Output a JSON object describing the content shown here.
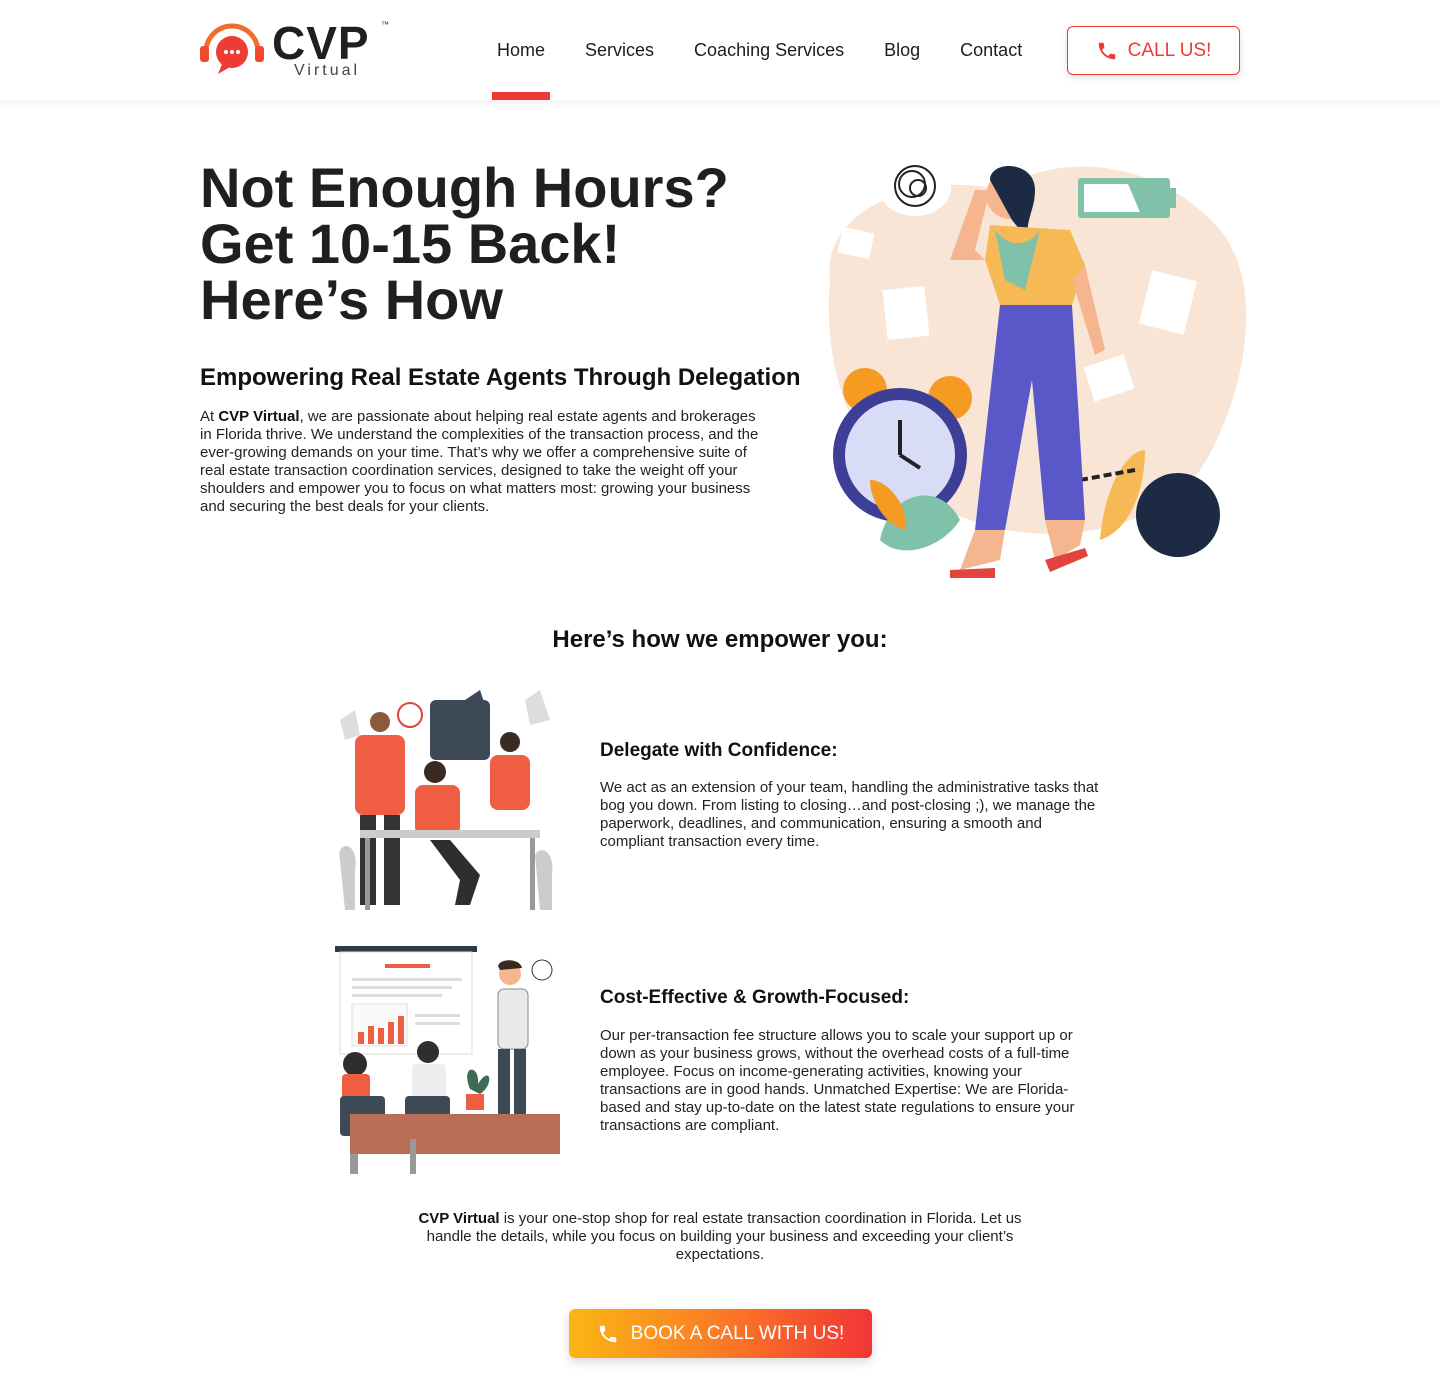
{
  "header": {
    "logo_text": "CVP",
    "logo_tm": "™",
    "logo_sub": "Virtual",
    "nav": [
      {
        "label": "Home",
        "active": true
      },
      {
        "label": "Services"
      },
      {
        "label": "Coaching Services"
      },
      {
        "label": "Blog"
      },
      {
        "label": "Contact"
      }
    ],
    "call_label": "CALL US!"
  },
  "hero": {
    "title_lines": [
      "Not Enough Hours?",
      "Get 10-15 Back!",
      "Here’s How"
    ],
    "subtitle": "Empowering Real Estate Agents Through Delegation",
    "para_prefix": "At ",
    "para_brand": "CVP Virtual",
    "para_rest": ", we are passionate about helping real estate agents and brokerages in Florida thrive. We understand the complexities of the transaction process, and the ever-growing demands on your time. That’s why we offer a comprehensive suite of real estate transaction coordination services, designed to take the weight off your shoulders and empower you to focus on what matters most: growing your business and securing the best deals for your clients."
  },
  "how": {
    "title": "Here’s how we empower you:",
    "features": [
      {
        "title": "Delegate with Confidence:",
        "text": "We act as an extension of your team, handling the administrative tasks that bog you down. From listing to closing…and post-closing ;), we manage the paperwork, deadlines, and communication, ensuring a smooth and compliant transaction every time."
      },
      {
        "title": "Cost-Effective & Growth-Focused:",
        "text": "Our per-transaction fee structure allows you to scale your support up or down as your business grows, without the overhead costs of a full-time employee. Focus on income-generating activities, knowing your transactions are in good hands. Unmatched Expertise: We are Florida-based and stay up-to-date on the latest state regulations to ensure your transactions are compliant."
      }
    ]
  },
  "closing": {
    "brand": "CVP Virtual",
    "text": " is your one-stop shop for real estate transaction coordination in Florida. Let us handle the details, while you focus on building your business and exceeding your client’s expectations."
  },
  "cta": {
    "label": "BOOK A CALL WITH US!"
  },
  "colors": {
    "accent": "#ef3b36",
    "gradient_start": "#fbb515",
    "gradient_end": "#f23535"
  }
}
